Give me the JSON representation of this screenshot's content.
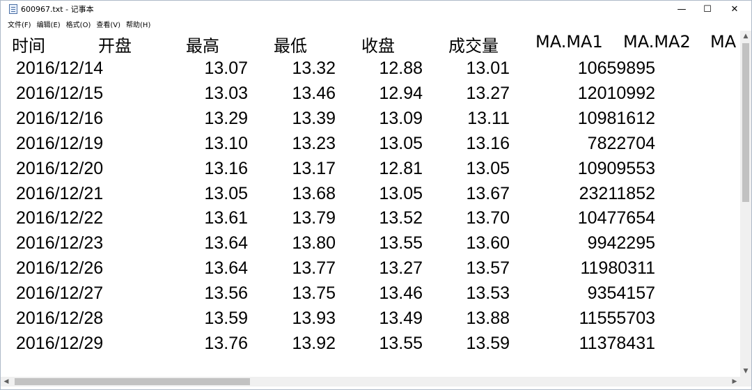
{
  "window": {
    "title": "600967.txt - 记事本",
    "minimize_glyph": "—",
    "maximize_glyph": "☐",
    "close_glyph": "✕"
  },
  "menu": [
    {
      "label": "文件(F)"
    },
    {
      "label": "编辑(E)"
    },
    {
      "label": "格式(O)"
    },
    {
      "label": "查看(V)"
    },
    {
      "label": "帮助(H)"
    }
  ],
  "table": {
    "headers": [
      "时间",
      "开盘",
      "最高",
      "最低",
      "收盘",
      "成交量",
      "MA.MA1",
      "MA.MA2",
      "MA"
    ],
    "rows": [
      {
        "date": "2016/12/14",
        "open": "13.07",
        "high": "13.32",
        "low": "12.88",
        "close": "13.01",
        "volume": "10659895"
      },
      {
        "date": "2016/12/15",
        "open": "13.03",
        "high": "13.46",
        "low": "12.94",
        "close": "13.27",
        "volume": "12010992"
      },
      {
        "date": "2016/12/16",
        "open": "13.29",
        "high": "13.39",
        "low": "13.09",
        "close": "13.11",
        "volume": "10981612"
      },
      {
        "date": "2016/12/19",
        "open": "13.10",
        "high": "13.23",
        "low": "13.05",
        "close": "13.16",
        "volume": "7822704"
      },
      {
        "date": "2016/12/20",
        "open": "13.16",
        "high": "13.17",
        "low": "12.81",
        "close": "13.05",
        "volume": "10909553"
      },
      {
        "date": "2016/12/21",
        "open": "13.05",
        "high": "13.68",
        "low": "13.05",
        "close": "13.67",
        "volume": "23211852"
      },
      {
        "date": "2016/12/22",
        "open": "13.61",
        "high": "13.79",
        "low": "13.52",
        "close": "13.70",
        "volume": "10477654"
      },
      {
        "date": "2016/12/23",
        "open": "13.64",
        "high": "13.80",
        "low": "13.55",
        "close": "13.60",
        "volume": "9942295"
      },
      {
        "date": "2016/12/26",
        "open": "13.64",
        "high": "13.77",
        "low": "13.27",
        "close": "13.57",
        "volume": "11980311"
      },
      {
        "date": "2016/12/27",
        "open": "13.56",
        "high": "13.75",
        "low": "13.46",
        "close": "13.53",
        "volume": "9354157"
      },
      {
        "date": "2016/12/28",
        "open": "13.59",
        "high": "13.93",
        "low": "13.49",
        "close": "13.88",
        "volume": "11555703"
      },
      {
        "date": "2016/12/29",
        "open": "13.76",
        "high": "13.92",
        "low": "13.55",
        "close": "13.59",
        "volume": "11378431"
      }
    ]
  },
  "scrollbars": {
    "up_glyph": "▲",
    "down_glyph": "▼",
    "left_glyph": "◀",
    "right_glyph": "▶"
  }
}
